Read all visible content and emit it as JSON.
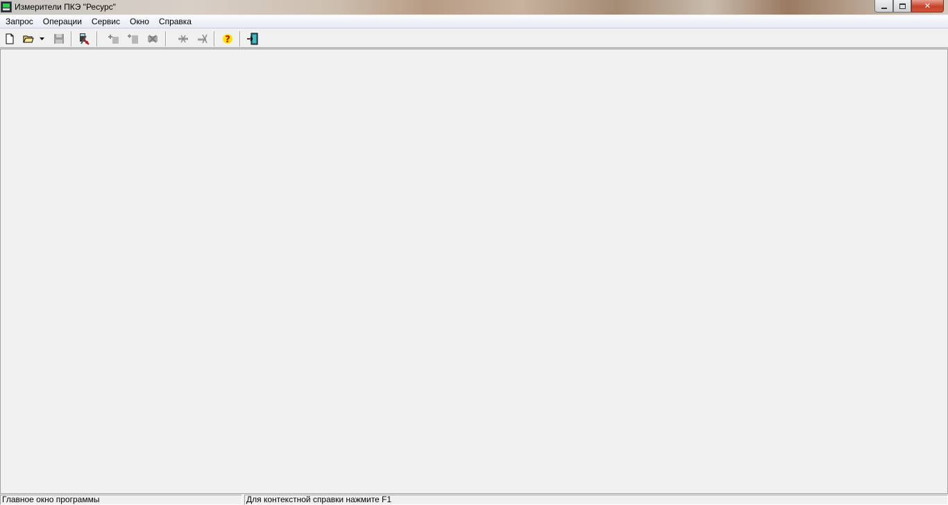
{
  "window": {
    "title": "Измерители ПКЭ \"Ресурс\""
  },
  "menu": {
    "items": [
      "Запрос",
      "Операции",
      "Сервис",
      "Окно",
      "Справка"
    ]
  },
  "toolbar": {
    "icons": [
      "new-document-icon",
      "open-folder-icon",
      "dropdown-arrow-icon",
      "save-disk-icon",
      "device-settings-icon",
      "add-record-icon",
      "insert-record-icon",
      "delete-record-icon",
      "disconnect-icon",
      "remove-connection-icon",
      "help-question-icon",
      "exit-door-icon"
    ]
  },
  "statusbar": {
    "left": "Главное окно программы",
    "right": "Для контекстной справки нажмите F1"
  }
}
